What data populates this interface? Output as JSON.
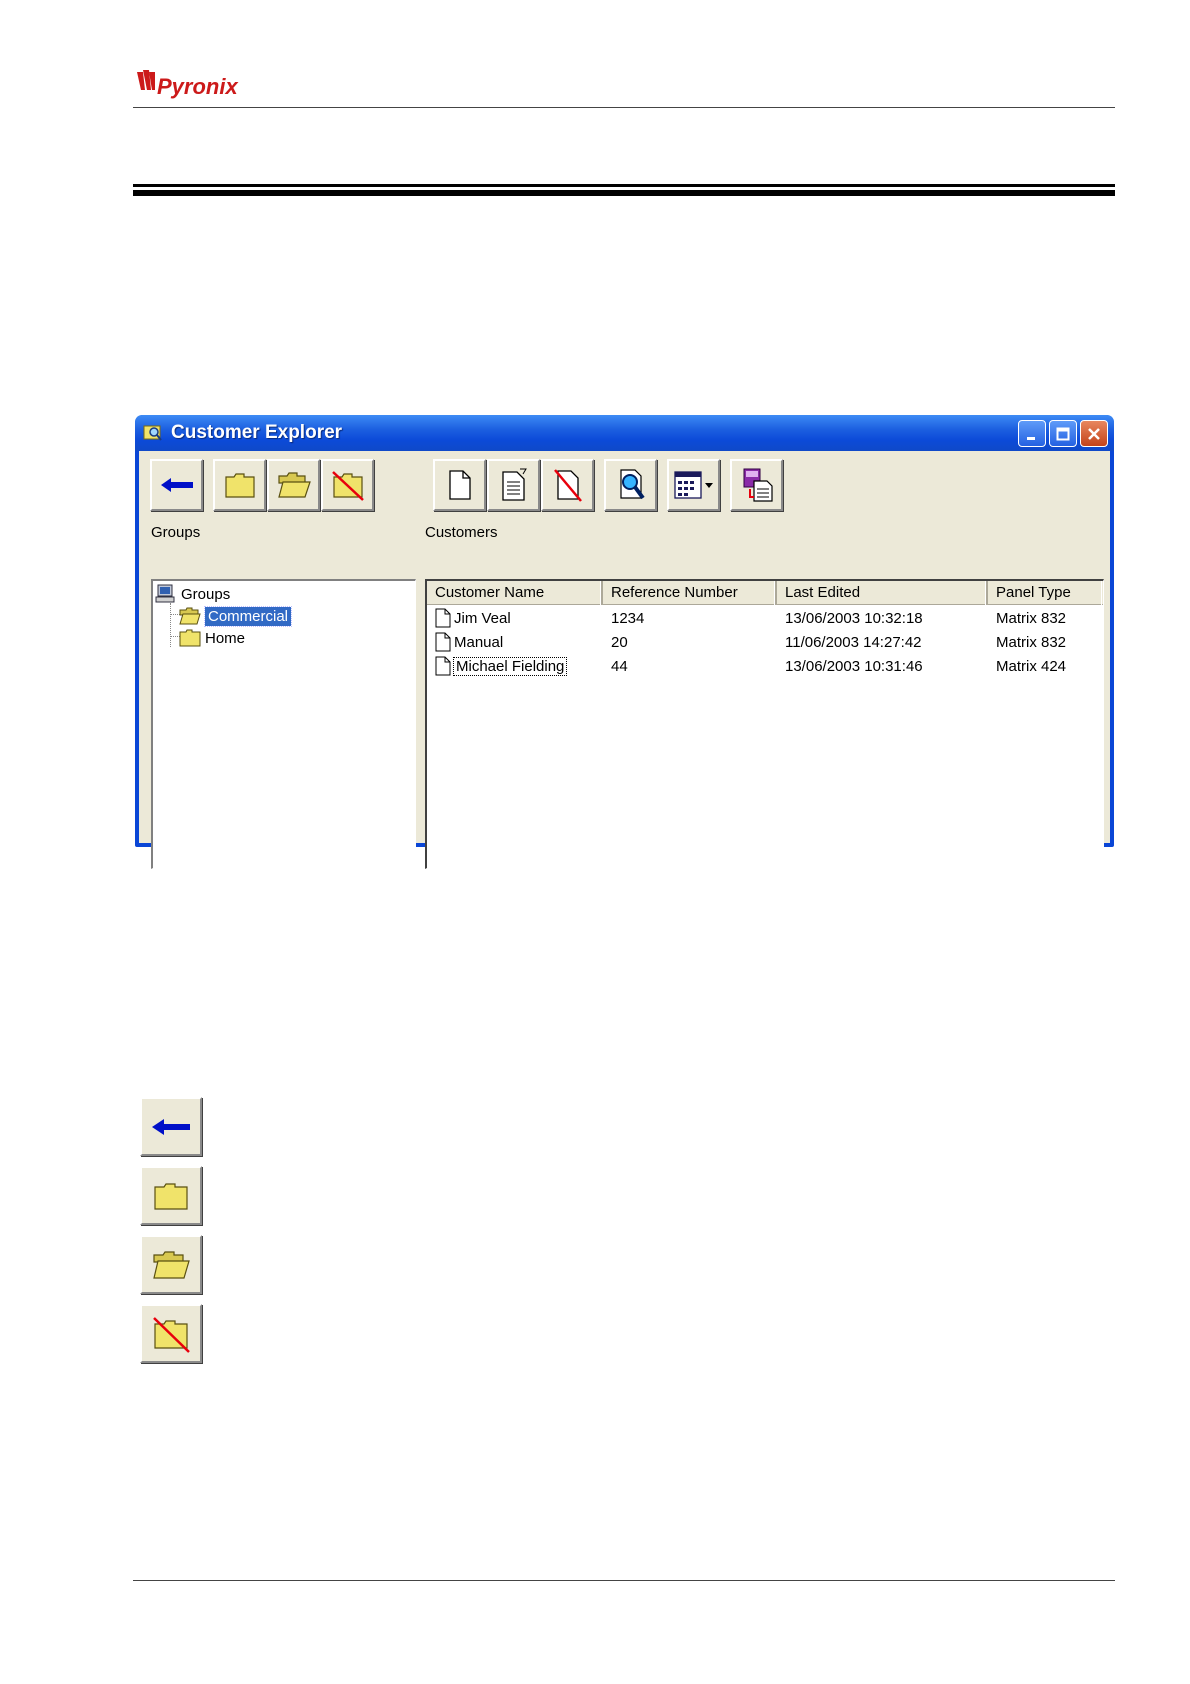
{
  "brand": {
    "logo_text": "Pyronix",
    "logo_color": "#cc1a1a"
  },
  "window": {
    "title": "Customer Explorer",
    "title_icon": "customer-explorer-icon",
    "controls": [
      "minimize-icon",
      "maximize-icon",
      "close-icon"
    ]
  },
  "toolbar": {
    "group_buttons": [
      {
        "icon": "back-arrow-icon",
        "tooltip": "Back"
      },
      {
        "icon": "new-folder-icon",
        "tooltip": "New Group"
      },
      {
        "icon": "open-folder-icon",
        "tooltip": "Open Group"
      },
      {
        "icon": "delete-folder-icon",
        "tooltip": "Delete Group"
      }
    ],
    "customer_buttons": [
      {
        "icon": "new-document-icon"
      },
      {
        "icon": "edit-document-icon"
      },
      {
        "icon": "delete-document-icon"
      },
      {
        "icon": "search-document-icon"
      },
      {
        "icon": "view-options-dropdown-icon"
      },
      {
        "icon": "export-document-icon"
      }
    ]
  },
  "groups": {
    "label": "Groups",
    "root": "Groups",
    "items": [
      {
        "label": "Commercial",
        "selected": true
      },
      {
        "label": "Home",
        "selected": false
      }
    ]
  },
  "customers": {
    "label": "Customers",
    "columns": [
      "Customer Name",
      "Reference Number",
      "Last Edited",
      "Panel Type"
    ],
    "rows": [
      {
        "name": "Jim Veal",
        "ref": "1234",
        "edited": "13/06/2003 10:32:18",
        "panel": "Matrix 832"
      },
      {
        "name": "Manual",
        "ref": "20",
        "edited": "11/06/2003 14:27:42",
        "panel": "Matrix 832"
      },
      {
        "name": "Michael Fielding",
        "ref": "44",
        "edited": "13/06/2003 10:31:46",
        "panel": "Matrix 424"
      }
    ]
  },
  "legend_icons": [
    "back-arrow-icon",
    "new-folder-icon",
    "open-folder-icon",
    "delete-folder-icon"
  ],
  "colors": {
    "titlebar": "#0c4ad8",
    "selection": "#316ac5",
    "folder": "#f0e36a",
    "face": "#ece9d8"
  }
}
